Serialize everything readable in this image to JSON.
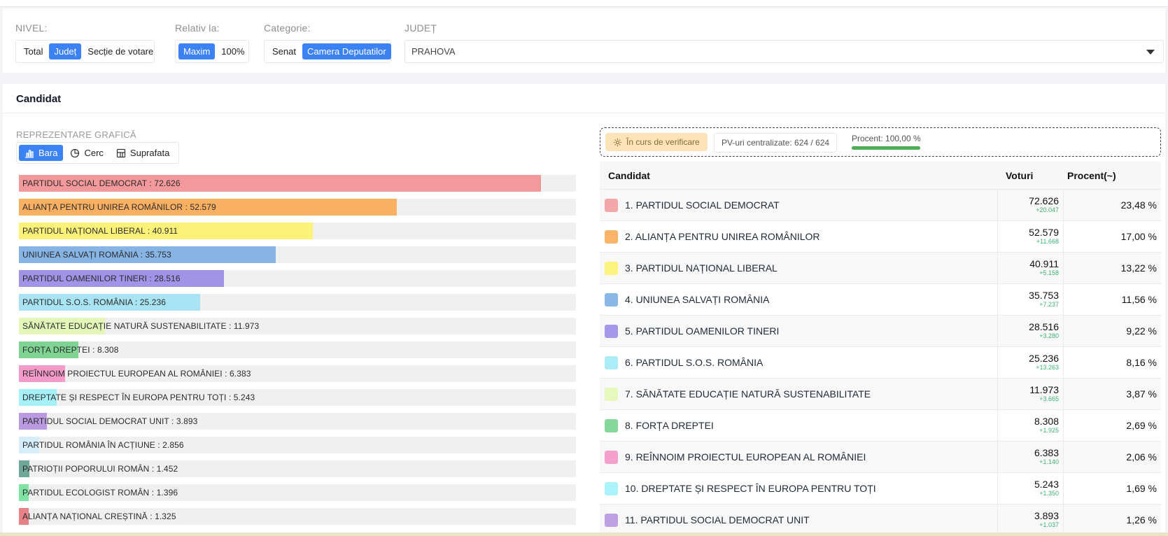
{
  "filters": {
    "nivel": {
      "label": "NIVEL:",
      "options": [
        "Total",
        "Județ",
        "Secție de votare"
      ],
      "selected": "Județ"
    },
    "relativ": {
      "label": "Relativ la:",
      "options": [
        "Maxim",
        "100%"
      ],
      "selected": "Maxim"
    },
    "categorie": {
      "label": "Categorie:",
      "options": [
        "Senat",
        "Camera Deputatilor"
      ],
      "selected": "Camera Deputatilor"
    },
    "judet": {
      "label": "JUDEȚ",
      "value": "PRAHOVA"
    }
  },
  "section_title": "Candidat",
  "graph": {
    "label": "REPREZENTARE GRAFICĂ",
    "buttons": [
      "Bara",
      "Cerc",
      "Suprafata"
    ],
    "selected": "Bara"
  },
  "status": {
    "verif": "În curs de verificare",
    "pv": "PV-uri centralizate: 624 / 624",
    "percent_text": "Procent: 100,00 %",
    "percent_value": 100
  },
  "table": {
    "headers": [
      "Candidat",
      "Voturi",
      "Procent(~)"
    ]
  },
  "chart_data": {
    "type": "bar",
    "max": 72626,
    "items": [
      {
        "name": "PARTIDUL SOCIAL DEMOCRAT",
        "label": "PARTIDUL SOCIAL DEMOCRAT : 72.626",
        "value": 72626,
        "color": "#f4999b"
      },
      {
        "name": "ALIANȚA PENTRU UNIREA ROMÂNILOR",
        "label": "ALIANȚA PENTRU UNIREA ROMÂNILOR : 52.579",
        "value": 52579,
        "color": "#f9b062"
      },
      {
        "name": "PARTIDUL NAȚIONAL LIBERAL",
        "label": "PARTIDUL NAȚIONAL LIBERAL : 40.911",
        "value": 40911,
        "color": "#fcf27a"
      },
      {
        "name": "UNIUNEA SALVAȚI ROMÂNIA",
        "label": "UNIUNEA SALVAȚI ROMÂNIA : 35.753",
        "value": 35753,
        "color": "#86b4e4"
      },
      {
        "name": "PARTIDUL OAMENILOR TINERI",
        "label": "PARTIDUL OAMENILOR TINERI : 28.516",
        "value": 28516,
        "color": "#a193e8"
      },
      {
        "name": "PARTIDUL S.O.S. ROMÂNIA",
        "label": "PARTIDUL S.O.S. ROMÂNIA : 25.236",
        "value": 25236,
        "color": "#a8e4f4"
      },
      {
        "name": "SĂNĂTATE EDUCAȚIE NATURĂ SUSTENABILITATE",
        "label": "SĂNĂTATE EDUCAȚIE NATURĂ SUSTENABILITATE : 11.973",
        "value": 11973,
        "color": "#e4f7b8"
      },
      {
        "name": "FORȚA DREPTEI",
        "label": "FORȚA DREPTEI : 8.308",
        "value": 8308,
        "color": "#7fd494"
      },
      {
        "name": "REÎNNOIM PROIECTUL EUROPEAN AL ROMÂNIEI",
        "label": "REÎNNOIM PROIECTUL EUROPEAN AL ROMÂNIEI : 6.383",
        "value": 6383,
        "color": "#f49ac8"
      },
      {
        "name": "DREPTATE ȘI RESPECT ÎN EUROPA PENTRU TOȚI",
        "label": "DREPTATE ȘI RESPECT ÎN EUROPA PENTRU TOȚI : 5.243",
        "value": 5243,
        "color": "#a6f0f8"
      },
      {
        "name": "PARTIDUL SOCIAL DEMOCRAT UNIT",
        "label": "PARTIDUL SOCIAL DEMOCRAT UNIT : 3.893",
        "value": 3893,
        "color": "#b99ae0"
      },
      {
        "name": "PARTIDUL ROMÂNIA ÎN ACȚIUNE",
        "label": "PARTIDUL ROMÂNIA ÎN ACȚIUNE : 2.856",
        "value": 2856,
        "color": "#d5eefa"
      },
      {
        "name": "PATRIOȚII POPORULUI ROMÂN",
        "label": "PATRIOȚII POPORULUI ROMÂN : 1.452",
        "value": 1452,
        "color": "#6fa898"
      },
      {
        "name": "PARTIDUL ECOLOGIST ROMÂN",
        "label": "PARTIDUL ECOLOGIST ROMÂN : 1.396",
        "value": 1396,
        "color": "#7ee3a3"
      },
      {
        "name": "ALIANȚA NAȚIONAL CREȘTINĂ",
        "label": "ALIANȚA NAȚIONAL CREȘTINĂ : 1.325",
        "value": 1325,
        "color": "#e98288"
      }
    ]
  },
  "rows": [
    {
      "name": "1. PARTIDUL SOCIAL DEMOCRAT",
      "votes": "72.626",
      "delta": "+20.047",
      "percent": "23,48 %",
      "color": "#f4a7a9"
    },
    {
      "name": "2. ALIANȚA PENTRU UNIREA ROMÂNILOR",
      "votes": "52.579",
      "delta": "+11.668",
      "percent": "17,00 %",
      "color": "#f9b46a"
    },
    {
      "name": "3. PARTIDUL NAȚIONAL LIBERAL",
      "votes": "40.911",
      "delta": "+5.158",
      "percent": "13,22 %",
      "color": "#fcf47e"
    },
    {
      "name": "4. UNIUNEA SALVAȚI ROMÂNIA",
      "votes": "35.753",
      "delta": "+7.237",
      "percent": "11,56 %",
      "color": "#8ab8e6"
    },
    {
      "name": "5. PARTIDUL OAMENILOR TINERI",
      "votes": "28.516",
      "delta": "+3.280",
      "percent": "9,22 %",
      "color": "#a598ea"
    },
    {
      "name": "6. PARTIDUL S.O.S. ROMÂNIA",
      "votes": "25.236",
      "delta": "+13.263",
      "percent": "8,16 %",
      "color": "#acecf7"
    },
    {
      "name": "7. SĂNĂTATE EDUCAȚIE NATURĂ SUSTENABILITATE",
      "votes": "11.973",
      "delta": "+3.665",
      "percent": "3,87 %",
      "color": "#e7f8bc"
    },
    {
      "name": "8. FORȚA DREPTEI",
      "votes": "8.308",
      "delta": "+1.925",
      "percent": "2,69 %",
      "color": "#86d89a"
    },
    {
      "name": "9. REÎNNOIM PROIECTUL EUROPEAN AL ROMÂNIEI",
      "votes": "6.383",
      "delta": "+1.140",
      "percent": "2,06 %",
      "color": "#f5a0cc"
    },
    {
      "name": "10. DREPTATE ȘI RESPECT ÎN EUROPA PENTRU TOȚI",
      "votes": "5.243",
      "delta": "+1.350",
      "percent": "1,69 %",
      "color": "#aaf3fa"
    },
    {
      "name": "11. PARTIDUL SOCIAL DEMOCRAT UNIT",
      "votes": "3.893",
      "delta": "+1.037",
      "percent": "1,26 %",
      "color": "#bea0e3"
    }
  ]
}
